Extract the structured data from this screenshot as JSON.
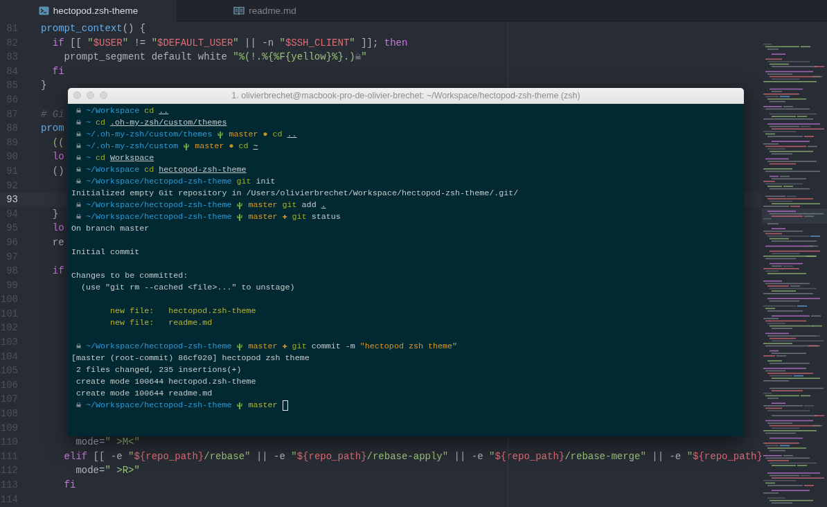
{
  "tabs": [
    {
      "label": "hectopod.zsh-theme",
      "kind": "shell",
      "selected": true
    },
    {
      "label": "readme.md",
      "kind": "markdown",
      "selected": false
    }
  ],
  "editor": {
    "lines": [
      {
        "number": "81",
        "current": false,
        "tokens": [
          {
            "kind": "function",
            "text": "prompt_context"
          },
          {
            "kind": "plain",
            "text": "() {"
          }
        ]
      },
      {
        "number": "82",
        "current": false,
        "tokens": [
          {
            "kind": "keyword",
            "text": "  if"
          },
          {
            "kind": "plain",
            "text": " [[ "
          },
          {
            "kind": "string",
            "text": "\""
          },
          {
            "kind": "variable",
            "text": "$USER"
          },
          {
            "kind": "string",
            "text": "\""
          },
          {
            "kind": "plain",
            "text": " != "
          },
          {
            "kind": "string",
            "text": "\""
          },
          {
            "kind": "variable",
            "text": "$DEFAULT_USER"
          },
          {
            "kind": "string",
            "text": "\""
          },
          {
            "kind": "plain",
            "text": " || -n "
          },
          {
            "kind": "string",
            "text": "\""
          },
          {
            "kind": "variable",
            "text": "$SSH_CLIENT"
          },
          {
            "kind": "string",
            "text": "\""
          },
          {
            "kind": "plain",
            "text": " ]]; "
          },
          {
            "kind": "keyword",
            "text": "then"
          }
        ]
      },
      {
        "number": "83",
        "current": false,
        "tokens": [
          {
            "kind": "plain",
            "text": "    prompt_segment default white "
          },
          {
            "kind": "string",
            "text": "\"%(!.%{%F{yellow}%}.)"
          },
          {
            "kind": "plain",
            "text": "☠"
          },
          {
            "kind": "string",
            "text": "\""
          }
        ]
      },
      {
        "number": "84",
        "current": false,
        "tokens": [
          {
            "kind": "keyword",
            "text": "  fi"
          }
        ]
      },
      {
        "number": "85",
        "current": false,
        "tokens": [
          {
            "kind": "plain",
            "text": "}"
          }
        ]
      },
      {
        "number": "86",
        "current": false
      },
      {
        "number": "87",
        "current": false,
        "tokens": [
          {
            "kind": "comment",
            "text": "# Gi"
          }
        ]
      },
      {
        "number": "88",
        "current": false,
        "tokens": [
          {
            "kind": "function",
            "text": "prom"
          }
        ]
      },
      {
        "number": "89",
        "current": false,
        "tokens": [
          {
            "kind": "string",
            "text": "  (("
          }
        ]
      },
      {
        "number": "90",
        "current": false,
        "tokens": [
          {
            "kind": "keyword",
            "text": "  lo"
          }
        ]
      },
      {
        "number": "91",
        "current": false,
        "tokens": [
          {
            "kind": "plain",
            "text": "  ()"
          }
        ]
      },
      {
        "number": "92",
        "current": false
      },
      {
        "number": "93",
        "current": true
      },
      {
        "number": "94",
        "current": false,
        "tokens": [
          {
            "kind": "plain",
            "text": "  }"
          }
        ]
      },
      {
        "number": "95",
        "current": false,
        "tokens": [
          {
            "kind": "keyword",
            "text": "  lo"
          }
        ]
      },
      {
        "number": "96",
        "current": false,
        "tokens": [
          {
            "kind": "plain",
            "text": "  re"
          }
        ]
      },
      {
        "number": "97",
        "current": false
      },
      {
        "number": "98",
        "current": false,
        "tokens": [
          {
            "kind": "keyword",
            "text": "  if"
          }
        ]
      },
      {
        "number": "99",
        "current": false
      },
      {
        "number": "100",
        "current": false
      },
      {
        "number": "101",
        "current": false
      },
      {
        "number": "102",
        "current": false
      },
      {
        "number": "103",
        "current": false
      },
      {
        "number": "104",
        "current": false
      },
      {
        "number": "105",
        "current": false
      },
      {
        "number": "106",
        "current": false
      },
      {
        "number": "107",
        "current": false
      },
      {
        "number": "108",
        "current": false
      },
      {
        "number": "109",
        "current": false
      },
      {
        "number": "110",
        "current": false,
        "tokens": [
          {
            "kind": "plain",
            "text": "      mode="
          },
          {
            "kind": "string",
            "text": "\" >M<\""
          }
        ]
      },
      {
        "number": "111",
        "current": false,
        "tokens": [
          {
            "kind": "keyword",
            "text": "    elif"
          },
          {
            "kind": "plain",
            "text": " [[ -e "
          },
          {
            "kind": "string",
            "text": "\""
          },
          {
            "kind": "variable",
            "text": "${repo_path}"
          },
          {
            "kind": "string",
            "text": "/rebase\""
          },
          {
            "kind": "plain",
            "text": " || -e "
          },
          {
            "kind": "string",
            "text": "\""
          },
          {
            "kind": "variable",
            "text": "${repo_path}"
          },
          {
            "kind": "string",
            "text": "/rebase-apply\""
          },
          {
            "kind": "plain",
            "text": " || -e "
          },
          {
            "kind": "string",
            "text": "\""
          },
          {
            "kind": "variable",
            "text": "${repo_path}"
          },
          {
            "kind": "string",
            "text": "/rebase-merge\""
          },
          {
            "kind": "plain",
            "text": " || -e "
          },
          {
            "kind": "string",
            "text": "\""
          },
          {
            "kind": "variable",
            "text": "${repo_path}"
          }
        ]
      },
      {
        "number": "112",
        "current": false,
        "tokens": [
          {
            "kind": "plain",
            "text": "      mode="
          },
          {
            "kind": "string",
            "text": "\" >R>\""
          }
        ]
      },
      {
        "number": "113",
        "current": false,
        "tokens": [
          {
            "kind": "keyword",
            "text": "    fi"
          }
        ]
      },
      {
        "number": "114",
        "current": false
      }
    ]
  },
  "terminal": {
    "title": "1. olivierbrechet@macbook-pro-de-olivier-brechet: ~/Workspace/hectopod-zsh-theme (zsh)",
    "lines": [
      {
        "kind": "prompt",
        "segments": [
          {
            "kind": "skull",
            "text": "☠"
          },
          {
            "kind": "path",
            "text": "~/Workspace"
          },
          {
            "kind": "command",
            "text": "cd"
          },
          {
            "kind": "link",
            "text": ".."
          }
        ]
      },
      {
        "kind": "prompt",
        "segments": [
          {
            "kind": "skull",
            "text": "☠"
          },
          {
            "kind": "path",
            "text": "~"
          },
          {
            "kind": "command",
            "text": "cd"
          },
          {
            "kind": "link",
            "text": ".oh-my-zsh/custom/themes"
          }
        ]
      },
      {
        "kind": "prompt",
        "segments": [
          {
            "kind": "skull",
            "text": "☠"
          },
          {
            "kind": "path",
            "text": "~/.oh-my-zsh/custom/themes"
          },
          {
            "kind": "cactus"
          },
          {
            "kind": "branch-dirty",
            "text": "master"
          },
          {
            "kind": "dirty",
            "text": "●"
          },
          {
            "kind": "command",
            "text": "cd"
          },
          {
            "kind": "link",
            "text": ".."
          }
        ]
      },
      {
        "kind": "prompt",
        "segments": [
          {
            "kind": "skull",
            "text": "☠"
          },
          {
            "kind": "path",
            "text": "~/.oh-my-zsh/custom"
          },
          {
            "kind": "cactus"
          },
          {
            "kind": "branch-dirty",
            "text": "master"
          },
          {
            "kind": "dirty",
            "text": "●"
          },
          {
            "kind": "command",
            "text": "cd"
          },
          {
            "kind": "link",
            "text": "~"
          }
        ]
      },
      {
        "kind": "prompt",
        "segments": [
          {
            "kind": "skull",
            "text": "☠"
          },
          {
            "kind": "path",
            "text": "~"
          },
          {
            "kind": "command",
            "text": "cd"
          },
          {
            "kind": "link",
            "text": "Workspace"
          }
        ]
      },
      {
        "kind": "prompt",
        "segments": [
          {
            "kind": "skull",
            "text": "☠"
          },
          {
            "kind": "path",
            "text": "~/Workspace"
          },
          {
            "kind": "command",
            "text": "cd"
          },
          {
            "kind": "link",
            "text": "hectopod-zsh-theme"
          }
        ]
      },
      {
        "kind": "prompt",
        "segments": [
          {
            "kind": "skull",
            "text": "☠"
          },
          {
            "kind": "path",
            "text": "~/Workspace/hectopod-zsh-theme"
          },
          {
            "kind": "command",
            "text": "git"
          },
          {
            "kind": "argument",
            "text": "init"
          }
        ]
      },
      {
        "kind": "output",
        "segments": [
          {
            "kind": "text",
            "text": "Initialized empty Git repository in /Users/olivierbrechet/Workspace/hectopod-zsh-theme/.git/"
          }
        ]
      },
      {
        "kind": "prompt",
        "segments": [
          {
            "kind": "skull",
            "text": "☠"
          },
          {
            "kind": "path",
            "text": "~/Workspace/hectopod-zsh-theme"
          },
          {
            "kind": "cactus"
          },
          {
            "kind": "branch-dirty",
            "text": "master"
          },
          {
            "kind": "command",
            "text": "git"
          },
          {
            "kind": "argument",
            "text": "add"
          },
          {
            "kind": "link",
            "text": "."
          }
        ]
      },
      {
        "kind": "prompt",
        "segments": [
          {
            "kind": "skull",
            "text": "☠"
          },
          {
            "kind": "path",
            "text": "~/Workspace/hectopod-zsh-theme"
          },
          {
            "kind": "cactus"
          },
          {
            "kind": "branch-dirty",
            "text": "master"
          },
          {
            "kind": "staged",
            "text": "✚"
          },
          {
            "kind": "command",
            "text": "git"
          },
          {
            "kind": "argument",
            "text": "status"
          }
        ]
      },
      {
        "kind": "output",
        "segments": [
          {
            "kind": "text",
            "text": "On branch master"
          }
        ]
      },
      {
        "kind": "blank"
      },
      {
        "kind": "output",
        "segments": [
          {
            "kind": "text",
            "text": "Initial commit"
          }
        ]
      },
      {
        "kind": "blank"
      },
      {
        "kind": "output",
        "segments": [
          {
            "kind": "text",
            "text": "Changes to be committed:"
          }
        ]
      },
      {
        "kind": "hint",
        "segments": [
          {
            "kind": "text",
            "text": "(use \"git rm --cached <file>...\" to unstage)"
          }
        ]
      },
      {
        "kind": "blank"
      },
      {
        "kind": "file",
        "segments": [
          {
            "kind": "staged-file",
            "text": "new file:   hectopod.zsh-theme"
          }
        ]
      },
      {
        "kind": "file",
        "segments": [
          {
            "kind": "staged-file",
            "text": "new file:   readme.md"
          }
        ]
      },
      {
        "kind": "blank"
      },
      {
        "kind": "prompt",
        "segments": [
          {
            "kind": "skull",
            "text": "☠"
          },
          {
            "kind": "path",
            "text": "~/Workspace/hectopod-zsh-theme"
          },
          {
            "kind": "cactus"
          },
          {
            "kind": "branch-dirty",
            "text": "master"
          },
          {
            "kind": "staged",
            "text": "✚"
          },
          {
            "kind": "command",
            "text": "git"
          },
          {
            "kind": "argument",
            "text": "commit -m"
          },
          {
            "kind": "string",
            "text": "\"hectopod zsh theme\""
          }
        ]
      },
      {
        "kind": "output",
        "segments": [
          {
            "kind": "text",
            "text": "[master (root-commit) 86cf020] hectopod zsh theme"
          }
        ]
      },
      {
        "kind": "summary",
        "segments": [
          {
            "kind": "text",
            "text": "2 files changed, 235 insertions(+)"
          }
        ]
      },
      {
        "kind": "summary",
        "segments": [
          {
            "kind": "text",
            "text": "create mode 100644 hectopod.zsh-theme"
          }
        ]
      },
      {
        "kind": "summary",
        "segments": [
          {
            "kind": "text",
            "text": "create mode 100644 readme.md"
          }
        ]
      },
      {
        "kind": "prompt",
        "segments": [
          {
            "kind": "skull",
            "text": "☠"
          },
          {
            "kind": "path",
            "text": "~/Workspace/hectopod-zsh-theme"
          },
          {
            "kind": "cactus"
          },
          {
            "kind": "branch-clean",
            "text": "master"
          },
          {
            "kind": "cursor"
          }
        ]
      }
    ]
  }
}
